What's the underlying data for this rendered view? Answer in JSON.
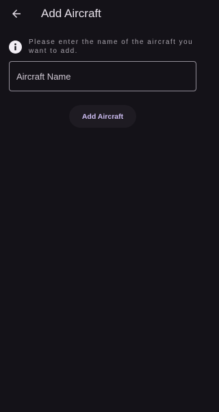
{
  "header": {
    "title": "Add Aircraft"
  },
  "icons": {
    "back": "arrow-back-icon",
    "info": "info-icon"
  },
  "info": {
    "message": "Please enter the name of the aircraft you want to add."
  },
  "form": {
    "aircraft_name": {
      "value": "",
      "placeholder": "Aircraft Name"
    },
    "submit_label": "Add Aircraft"
  },
  "colors": {
    "background": "#141218",
    "text": "#e6e0e9",
    "muted_text": "#a9a4ad",
    "outline": "#948f99",
    "button_bg": "#1e1b22",
    "accent": "#cdbdf2"
  }
}
